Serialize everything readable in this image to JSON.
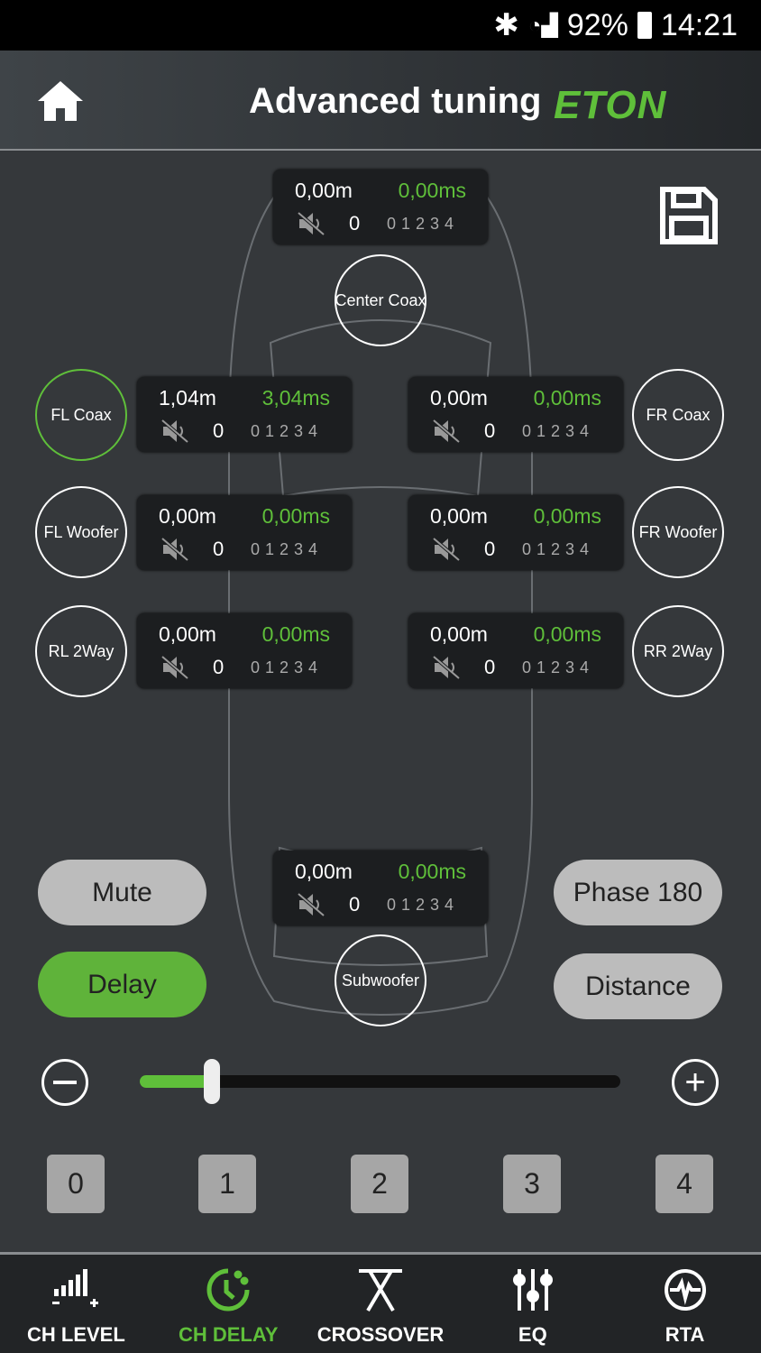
{
  "status": {
    "battery": "92%",
    "time": "14:21"
  },
  "header": {
    "title": "Advanced tuning",
    "logo": "ETON"
  },
  "accent": "#5fbf3a",
  "channels": [
    {
      "name": "Center Coax",
      "distance": "0,00m",
      "delay": "0,00ms",
      "phase": "0",
      "scale": "01234"
    },
    {
      "name": "FL Coax",
      "distance": "1,04m",
      "delay": "3,04ms",
      "phase": "0",
      "scale": "01234",
      "selected": true
    },
    {
      "name": "FR Coax",
      "distance": "0,00m",
      "delay": "0,00ms",
      "phase": "0",
      "scale": "01234"
    },
    {
      "name": "FL Woofer",
      "distance": "0,00m",
      "delay": "0,00ms",
      "phase": "0",
      "scale": "01234"
    },
    {
      "name": "FR Woofer",
      "distance": "0,00m",
      "delay": "0,00ms",
      "phase": "0",
      "scale": "01234"
    },
    {
      "name": "RL 2Way",
      "distance": "0,00m",
      "delay": "0,00ms",
      "phase": "0",
      "scale": "01234"
    },
    {
      "name": "RR 2Way",
      "distance": "0,00m",
      "delay": "0,00ms",
      "phase": "0",
      "scale": "01234"
    },
    {
      "name": "Subwoofer",
      "distance": "0,00m",
      "delay": "0,00ms",
      "phase": "0",
      "scale": "01234"
    }
  ],
  "buttons": {
    "mute": "Mute",
    "phase": "Phase 180",
    "delay": "Delay",
    "distance": "Distance"
  },
  "slider": {
    "value_fraction": 0.15
  },
  "steps": [
    "0",
    "1",
    "2",
    "3",
    "4"
  ],
  "nav": [
    {
      "label": "CH LEVEL",
      "icon": "signal-level-icon"
    },
    {
      "label": "CH DELAY",
      "icon": "clock-delay-icon",
      "active": true
    },
    {
      "label": "CROSSOVER",
      "icon": "crossover-icon"
    },
    {
      "label": "EQ",
      "icon": "equalizer-sliders-icon"
    },
    {
      "label": "RTA",
      "icon": "waveform-icon"
    }
  ]
}
